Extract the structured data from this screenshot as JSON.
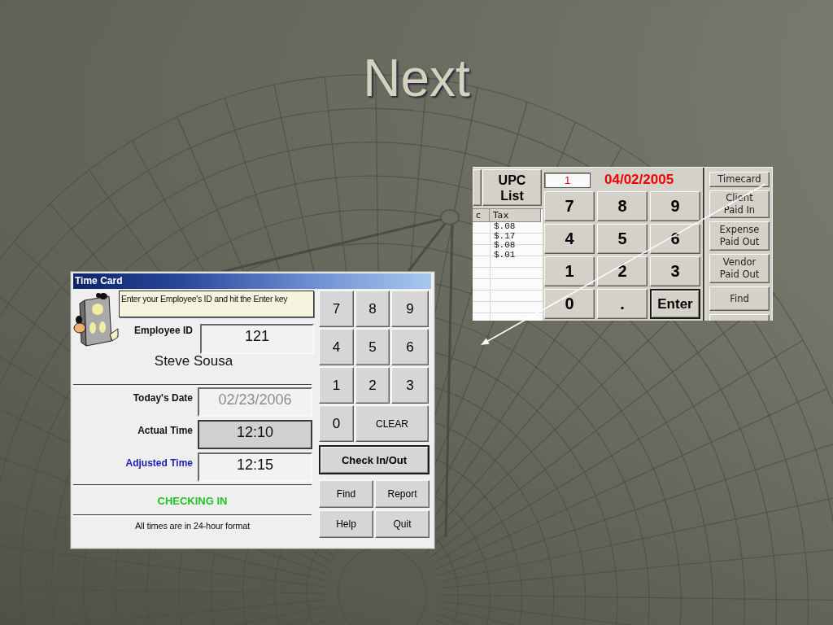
{
  "slide": {
    "title": "Next"
  },
  "pos_screen": {
    "upc_button": "UPC\nList",
    "table": {
      "columns": [
        "c",
        "Tax"
      ],
      "tax_values": [
        "$.08",
        "$.17",
        "$.08",
        "$.01"
      ]
    },
    "counter": "1",
    "date": "04/02/2005",
    "keypad": [
      {
        "label": "7",
        "kind": "digit"
      },
      {
        "label": "8",
        "kind": "digit"
      },
      {
        "label": "9",
        "kind": "digit"
      },
      {
        "label": "4",
        "kind": "digit"
      },
      {
        "label": "5",
        "kind": "digit"
      },
      {
        "label": "6",
        "kind": "digit"
      },
      {
        "label": "1",
        "kind": "digit"
      },
      {
        "label": "2",
        "kind": "digit"
      },
      {
        "label": "3",
        "kind": "digit"
      },
      {
        "label": "0",
        "kind": "digit"
      },
      {
        "label": ".",
        "kind": "digit"
      },
      {
        "label": "Enter",
        "kind": "enter"
      }
    ],
    "side_buttons": [
      "Timecard",
      "Client\nPaid In",
      "Expense\nPaid Out",
      "Vendor\nPaid Out",
      "Find"
    ]
  },
  "time_card": {
    "title": "Time Card",
    "instruction": "Enter your Employee's ID and hit the Enter key",
    "employee_id": {
      "label": "Employee ID",
      "value": "121"
    },
    "employee_name": "Steve Sousa",
    "times": [
      {
        "label": "Today's Date",
        "value": "02/23/2006",
        "kind": "date",
        "disabled": true
      },
      {
        "label": "Actual Time",
        "value": "12:10",
        "kind": "actual",
        "disabled": false
      },
      {
        "label": "Adjusted Time",
        "value": "12:15",
        "kind": "adjusted",
        "disabled": false
      }
    ],
    "status": "CHECKING IN",
    "note": "All times are in 24-hour format",
    "keypad": [
      {
        "label": "7",
        "kind": "digit"
      },
      {
        "label": "8",
        "kind": "digit"
      },
      {
        "label": "9",
        "kind": "digit"
      },
      {
        "label": "4",
        "kind": "digit"
      },
      {
        "label": "5",
        "kind": "digit"
      },
      {
        "label": "6",
        "kind": "digit"
      },
      {
        "label": "1",
        "kind": "digit"
      },
      {
        "label": "2",
        "kind": "digit"
      },
      {
        "label": "3",
        "kind": "digit"
      },
      {
        "label": "0",
        "kind": "digit"
      },
      {
        "label": "CLEAR",
        "kind": "clear"
      }
    ],
    "check_button": "Check In/Out",
    "buttons": [
      "Find",
      "Report",
      "Help",
      "Quit"
    ]
  }
}
